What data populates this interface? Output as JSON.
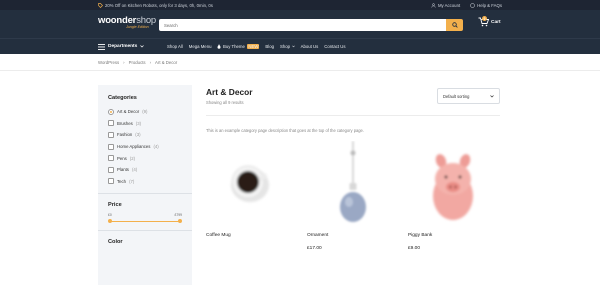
{
  "topbar": {
    "promo": "20% Off on Kitchen Robots, only for 3 days, 0h, 0min, 0s",
    "my_account": "My Account",
    "help": "Help & FAQs"
  },
  "header": {
    "logo_main": "woonder",
    "logo_shop": "shop",
    "logo_edition": "Jungle Edition",
    "search_placeholder": "Search",
    "cart_label": "Cart",
    "cart_count": "0"
  },
  "nav": {
    "departments": "Departments",
    "items": [
      "Shop All",
      "Mega Menu",
      "Buy Theme",
      "Blog",
      "Shop",
      "About Us",
      "Contact Us"
    ],
    "new_badge": "NEW"
  },
  "breadcrumb": [
    "WordPress",
    "Products",
    "Art & Decor"
  ],
  "sidebar": {
    "categories_title": "Categories",
    "categories": [
      {
        "label": "Art & Decor",
        "count": "(9)"
      },
      {
        "label": "Brushes",
        "count": "(3)"
      },
      {
        "label": "Fashion",
        "count": "(3)"
      },
      {
        "label": "Home Appliances",
        "count": "(4)"
      },
      {
        "label": "Pens",
        "count": "(2)"
      },
      {
        "label": "Plants",
        "count": "(4)"
      },
      {
        "label": "Tech",
        "count": "(7)"
      }
    ],
    "price_title": "Price",
    "price_min": "£0",
    "price_max": "£799",
    "color_title": "Color"
  },
  "main": {
    "title": "Art & Decor",
    "results": "Showing all 9 results",
    "sort_label": "Default sorting",
    "description": "This is an example category page description that goes at the top of the category page.",
    "products": [
      {
        "name": "Coffee Mug",
        "price": ""
      },
      {
        "name": "Ornament",
        "price": "£17.00"
      },
      {
        "name": "Piggy Bank",
        "price": "£9.00"
      }
    ]
  },
  "colors": {
    "header_bg": "#232f3e",
    "topbar_bg": "#1e2533",
    "accent": "#f3b04c"
  }
}
